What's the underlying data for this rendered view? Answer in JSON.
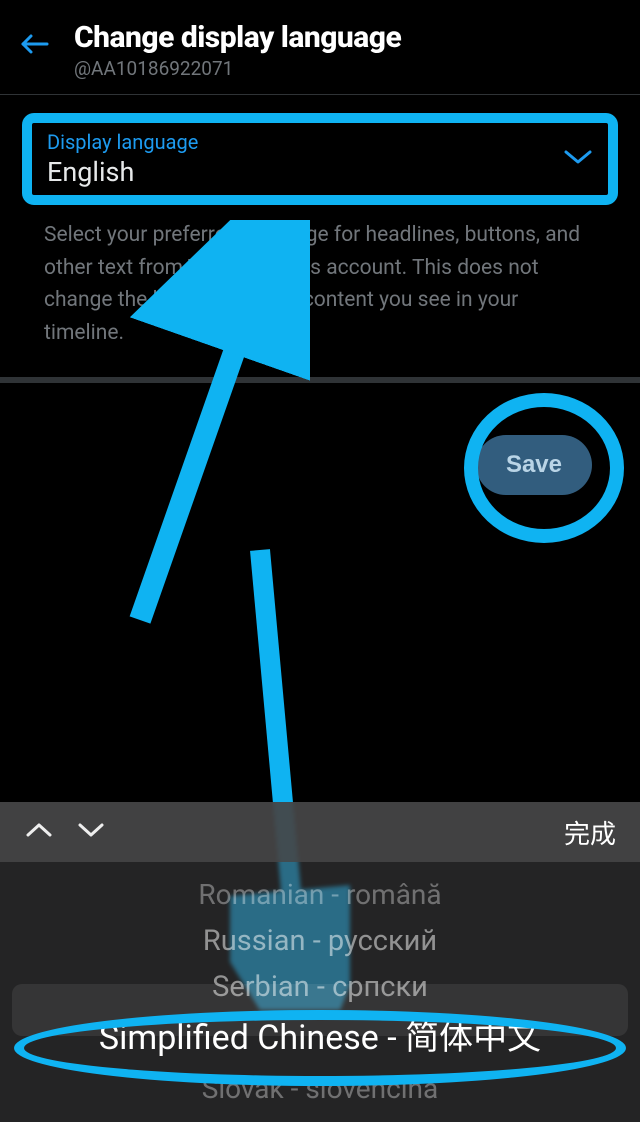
{
  "header": {
    "title": "Change display language",
    "username": "@AA10186922071"
  },
  "field": {
    "label": "Display language",
    "value": "English"
  },
  "helper_text": "Select your preferred language for headlines, buttons, and other text from Twitter on this account. This does not change the language of the content you see in your timeline.",
  "buttons": {
    "save": "Save"
  },
  "picker": {
    "done_label": "完成",
    "options": [
      "Romanian - română",
      "Russian - русский",
      "Serbian - српски",
      "Simplified Chinese - 简体中文",
      "Slovak - slovenčina"
    ],
    "selected_index": 3
  },
  "annotations": {
    "arrow1_from": "picker-area",
    "arrow1_to": "display-language-dropdown",
    "arrow2_from": "picker-area",
    "arrow2_to": "picker-selected-option",
    "circle_on": "save-button",
    "rect_on": "display-language-dropdown",
    "ellipse_on": "picker-selected-option"
  },
  "colors": {
    "accent": "#1d9bf0",
    "highlight": "#0fb3f2",
    "save_bg": "#325d7e"
  }
}
